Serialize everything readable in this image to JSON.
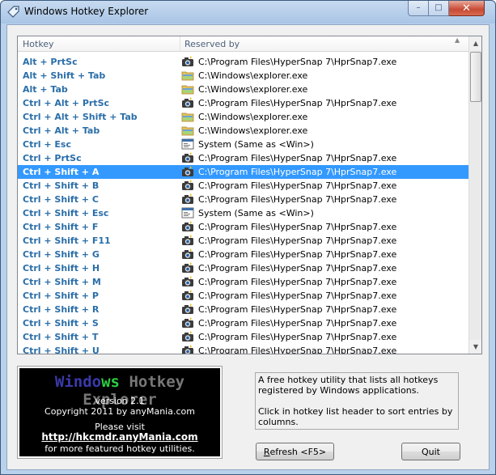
{
  "window": {
    "title": "Windows Hotkey Explorer",
    "minimize_glyph": "–",
    "maximize_glyph": "□",
    "close_glyph": "✕"
  },
  "list": {
    "columns": [
      "Hotkey",
      "Reserved by"
    ],
    "selected_index": 8,
    "rows": [
      {
        "hotkey": "Alt + PrtSc",
        "reserved_by": "C:\\Program Files\\HyperSnap 7\\HprSnap7.exe",
        "icon": "hypersnap-icon"
      },
      {
        "hotkey": "Alt + Shift + Tab",
        "reserved_by": "C:\\Windows\\explorer.exe",
        "icon": "explorer-icon"
      },
      {
        "hotkey": "Alt + Tab",
        "reserved_by": "C:\\Windows\\explorer.exe",
        "icon": "explorer-icon"
      },
      {
        "hotkey": "Ctrl + Alt + PrtSc",
        "reserved_by": "C:\\Program Files\\HyperSnap 7\\HprSnap7.exe",
        "icon": "hypersnap-icon"
      },
      {
        "hotkey": "Ctrl + Alt + Shift + Tab",
        "reserved_by": "C:\\Windows\\explorer.exe",
        "icon": "explorer-icon"
      },
      {
        "hotkey": "Ctrl + Alt + Tab",
        "reserved_by": "C:\\Windows\\explorer.exe",
        "icon": "explorer-icon"
      },
      {
        "hotkey": "Ctrl + Esc",
        "reserved_by": "System (Same as <Win>)",
        "icon": "system-icon"
      },
      {
        "hotkey": "Ctrl + PrtSc",
        "reserved_by": "C:\\Program Files\\HyperSnap 7\\HprSnap7.exe",
        "icon": "hypersnap-icon"
      },
      {
        "hotkey": "Ctrl + Shift + A",
        "reserved_by": "C:\\Program Files\\HyperSnap 7\\HprSnap7.exe",
        "icon": "hypersnap-icon"
      },
      {
        "hotkey": "Ctrl + Shift + B",
        "reserved_by": "C:\\Program Files\\HyperSnap 7\\HprSnap7.exe",
        "icon": "hypersnap-icon"
      },
      {
        "hotkey": "Ctrl + Shift + C",
        "reserved_by": "C:\\Program Files\\HyperSnap 7\\HprSnap7.exe",
        "icon": "hypersnap-icon"
      },
      {
        "hotkey": "Ctrl + Shift + Esc",
        "reserved_by": "System (Same as <Win>)",
        "icon": "system-icon"
      },
      {
        "hotkey": "Ctrl + Shift + F",
        "reserved_by": "C:\\Program Files\\HyperSnap 7\\HprSnap7.exe",
        "icon": "hypersnap-icon"
      },
      {
        "hotkey": "Ctrl + Shift + F11",
        "reserved_by": "C:\\Program Files\\HyperSnap 7\\HprSnap7.exe",
        "icon": "hypersnap-icon"
      },
      {
        "hotkey": "Ctrl + Shift + G",
        "reserved_by": "C:\\Program Files\\HyperSnap 7\\HprSnap7.exe",
        "icon": "hypersnap-icon"
      },
      {
        "hotkey": "Ctrl + Shift + H",
        "reserved_by": "C:\\Program Files\\HyperSnap 7\\HprSnap7.exe",
        "icon": "hypersnap-icon"
      },
      {
        "hotkey": "Ctrl + Shift + M",
        "reserved_by": "C:\\Program Files\\HyperSnap 7\\HprSnap7.exe",
        "icon": "hypersnap-icon"
      },
      {
        "hotkey": "Ctrl + Shift + P",
        "reserved_by": "C:\\Program Files\\HyperSnap 7\\HprSnap7.exe",
        "icon": "hypersnap-icon"
      },
      {
        "hotkey": "Ctrl + Shift + R",
        "reserved_by": "C:\\Program Files\\HyperSnap 7\\HprSnap7.exe",
        "icon": "hypersnap-icon"
      },
      {
        "hotkey": "Ctrl + Shift + S",
        "reserved_by": "C:\\Program Files\\HyperSnap 7\\HprSnap7.exe",
        "icon": "hypersnap-icon"
      },
      {
        "hotkey": "Ctrl + Shift + T",
        "reserved_by": "C:\\Program Files\\HyperSnap 7\\HprSnap7.exe",
        "icon": "hypersnap-icon"
      },
      {
        "hotkey": "Ctrl + Shift + U",
        "reserved_by": "C:\\Program Files\\HyperSnap 7\\HprSnap7.exe",
        "icon": "hypersnap-icon"
      }
    ]
  },
  "logo": {
    "title_a": "Windo",
    "title_b": "ws",
    "title_c": " Hotkey Explorer",
    "version": "version 2.1",
    "copyright": "Copyright 2011 by anyMania.com",
    "visit": "Please visit",
    "link": "http://hkcmdr.anyMania.com",
    "more": "for more featured hotkey utilities."
  },
  "description": {
    "line1": "A free hotkey utility that lists all hotkeys registered by Windows applications.",
    "line2": "Click in hotkey list header to sort entries by columns."
  },
  "buttons": {
    "refresh_mnemonic": "R",
    "refresh_rest": "efresh <F5>",
    "quit": "Quit"
  },
  "colors": {
    "hotkey_text": "#2a6ea8",
    "selection": "#3399ff",
    "logo_bg": "#000000"
  }
}
